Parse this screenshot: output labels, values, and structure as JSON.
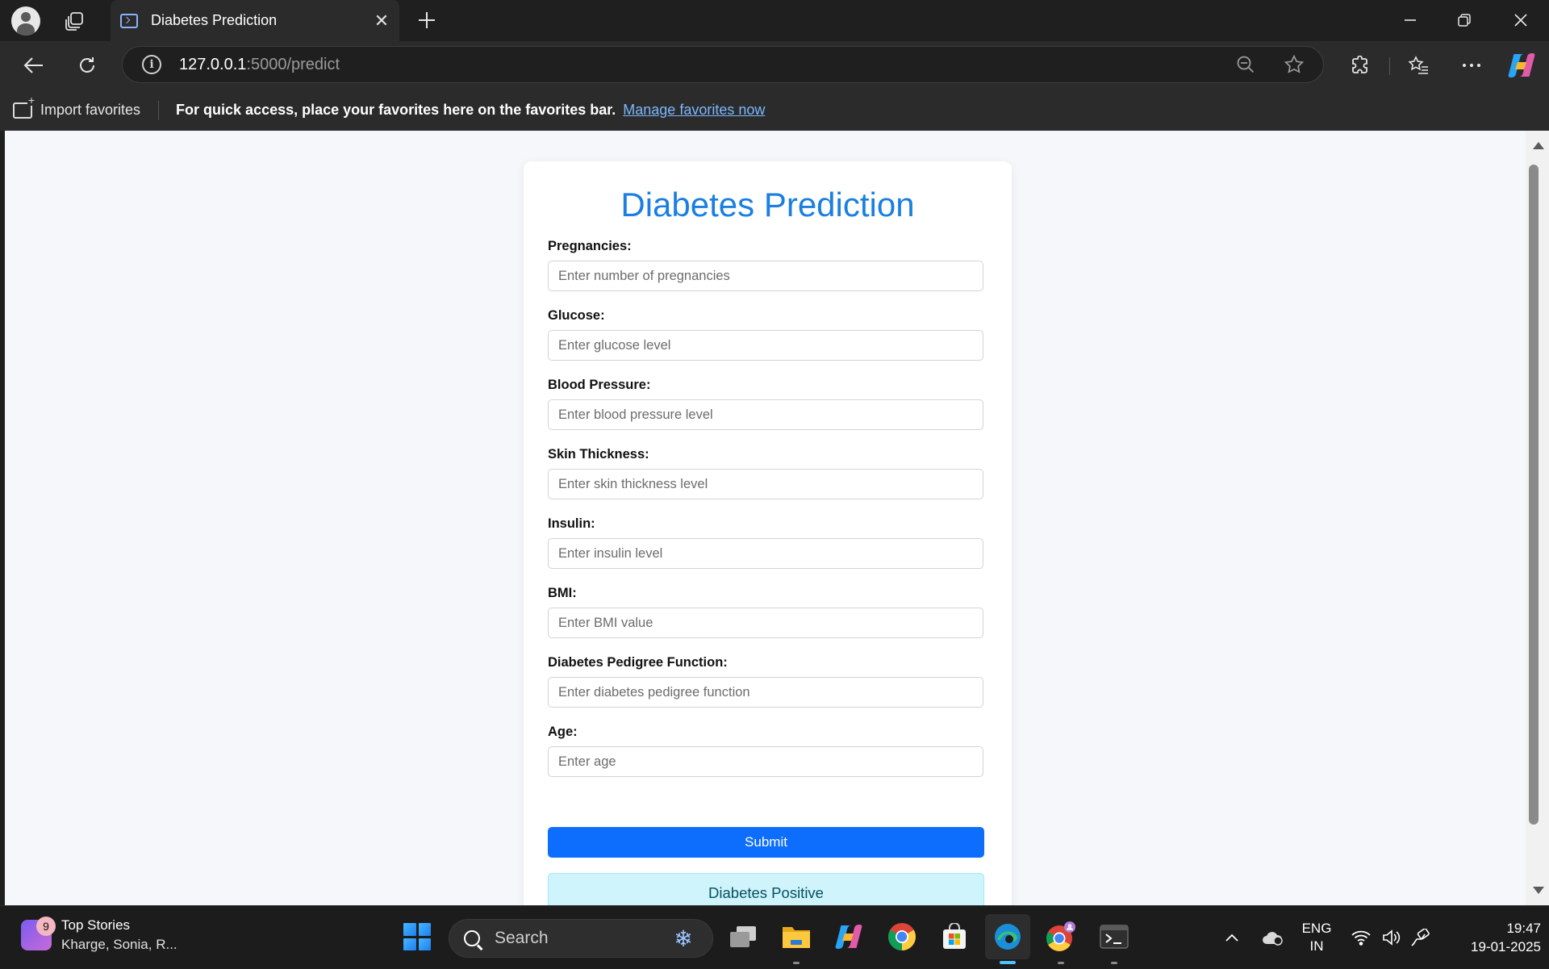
{
  "browser": {
    "tab_title": "Diabetes Prediction",
    "url_host": "127.0.0.1",
    "url_rest": ":5000/predict"
  },
  "favorites_bar": {
    "import_label": "Import favorites",
    "hint": "For quick access, place your favorites here on the favorites bar.",
    "manage_link": "Manage favorites now"
  },
  "page": {
    "title": "Diabetes Prediction",
    "fields": [
      {
        "label": "Pregnancies:",
        "placeholder": "Enter number of pregnancies",
        "value": ""
      },
      {
        "label": "Glucose:",
        "placeholder": "Enter glucose level",
        "value": ""
      },
      {
        "label": "Blood Pressure:",
        "placeholder": "Enter blood pressure level",
        "value": ""
      },
      {
        "label": "Skin Thickness:",
        "placeholder": "Enter skin thickness level",
        "value": ""
      },
      {
        "label": "Insulin:",
        "placeholder": "Enter insulin level",
        "value": ""
      },
      {
        "label": "BMI:",
        "placeholder": "Enter BMI value",
        "value": ""
      },
      {
        "label": "Diabetes Pedigree Function:",
        "placeholder": "Enter diabetes pedigree function",
        "value": ""
      },
      {
        "label": "Age:",
        "placeholder": "Enter age",
        "value": ""
      }
    ],
    "submit_label": "Submit",
    "result_text": "Diabetes Positive"
  },
  "colors": {
    "title": "#1a7fe0",
    "submit_bg": "#0d6efd",
    "result_bg": "#cff4fc",
    "result_text": "#055160"
  },
  "taskbar": {
    "widget_badge": "9",
    "widget_title": "Top Stories",
    "widget_subtitle": "Kharge, Sonia, R...",
    "search_label": "Search",
    "apps": [
      "task-view-icon",
      "file-explorer-icon",
      "copilot-icon",
      "chrome-icon",
      "microsoft-store-icon",
      "edge-icon",
      "chrome-profile-icon",
      "terminal-icon"
    ],
    "lang_line1": "ENG",
    "lang_line2": "IN",
    "time": "19:47",
    "date": "19-01-2025"
  }
}
